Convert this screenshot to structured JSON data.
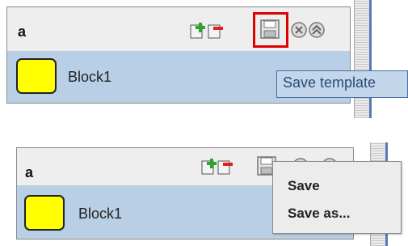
{
  "panels": [
    {
      "title": "a",
      "block": {
        "label": "Block1",
        "color": "#ffff00"
      }
    },
    {
      "title": "a",
      "block": {
        "label": "Block1",
        "color": "#ffff00"
      }
    }
  ],
  "tooltip": {
    "text": "Save template"
  },
  "save_menu": {
    "items": [
      "Save",
      "Save as..."
    ]
  },
  "colors": {
    "highlight": "#e00000",
    "body": "#b8cfe6",
    "tooltip_bg": "#c3d6ec"
  },
  "icons": [
    "add-icon",
    "remove-icon",
    "save-icon",
    "close-icon",
    "collapse-icon"
  ]
}
